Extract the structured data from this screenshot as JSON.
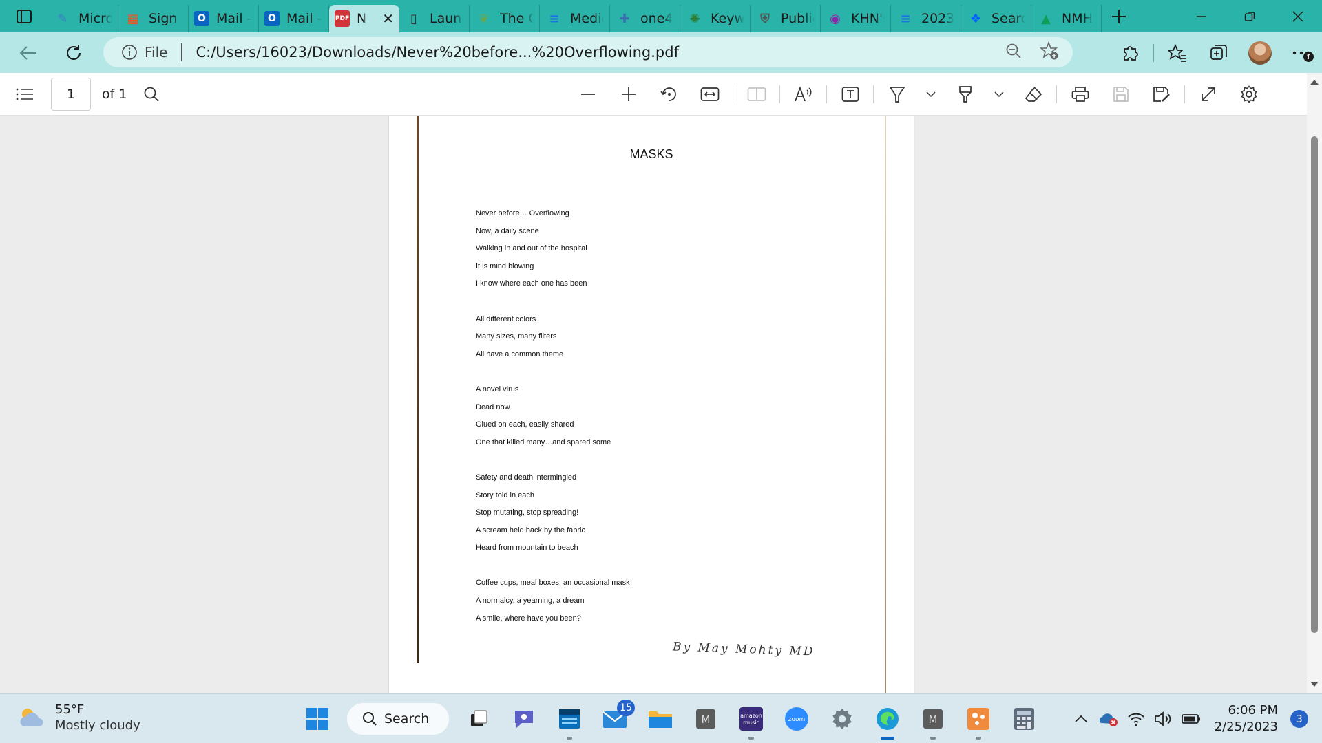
{
  "browser": {
    "tabs": [
      {
        "label": "Micro",
        "icon": "feather-icon",
        "color": "#3b82c4"
      },
      {
        "label": "Sign i",
        "icon": "microsoft-icon",
        "color": "#f25022"
      },
      {
        "label": "Mail -",
        "icon": "outlook-icon",
        "color": "#0a64c2"
      },
      {
        "label": "Mail -",
        "icon": "outlook-icon",
        "color": "#0a64c2"
      },
      {
        "label": "N",
        "icon": "pdf-icon",
        "color": "#d13438",
        "active": true
      },
      {
        "label": "Launc",
        "icon": "document-icon",
        "color": "#333333"
      },
      {
        "label": "The C",
        "icon": "leaf-icon",
        "color": "#6aa84f"
      },
      {
        "label": "Medic",
        "icon": "docs-icon",
        "color": "#1a73e8"
      },
      {
        "label": "one4",
        "icon": "plus-icon",
        "color": "#3a6fb0"
      },
      {
        "label": "Keyw",
        "icon": "palm-icon",
        "color": "#2e7d32"
      },
      {
        "label": "Public",
        "icon": "shield-icon",
        "color": "#555555"
      },
      {
        "label": "KHN's",
        "icon": "podcast-icon",
        "color": "#8e24aa"
      },
      {
        "label": "2023",
        "icon": "docs-icon",
        "color": "#1a73e8"
      },
      {
        "label": "Searc",
        "icon": "dropbox-icon",
        "color": "#0061fe"
      },
      {
        "label": "NMH",
        "icon": "drive-icon",
        "color": "#0f9d58"
      }
    ],
    "address": {
      "scheme_label": "File",
      "url": "C:/Users/16023/Downloads/Never%20before...%20Overflowing.pdf"
    }
  },
  "pdf": {
    "page_number": "1",
    "page_count": "of 1"
  },
  "document": {
    "title": "MASKS",
    "stanzas": [
      [
        "Never before… Overflowing",
        "Now, a daily scene",
        "Walking in and out of the hospital",
        "It is mind blowing",
        "I know where each one has been"
      ],
      [
        "All different colors",
        "Many sizes, many filters",
        "All have a common theme"
      ],
      [
        "A novel virus",
        "Dead now",
        "Glued on each, easily shared",
        "One that killed many…and spared some"
      ],
      [
        "Safety and death intermingled",
        "Story told in each",
        "Stop mutating, stop spreading!",
        "A scream held back by the fabric",
        "Heard from mountain to beach"
      ],
      [
        "Coffee cups, meal boxes, an occasional mask",
        "A normalcy, a yearning, a dream",
        "A smile, where have you been?"
      ]
    ],
    "signature": "By May Mohty MD"
  },
  "taskbar": {
    "weather_temp": "55°F",
    "weather_condition": "Mostly cloudy",
    "search_label": "Search",
    "mail_badge": "15",
    "time": "6:06 PM",
    "date": "2/25/2023",
    "notification_count": "3"
  }
}
